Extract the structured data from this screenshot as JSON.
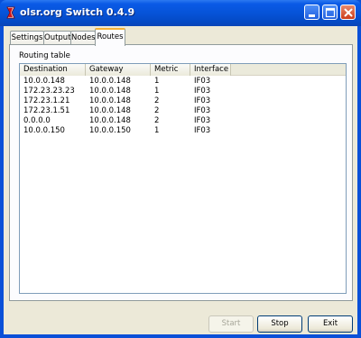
{
  "window": {
    "title": "olsr.org Switch 0.4.9",
    "colors": {
      "titlebar": "#0653d8",
      "tab_highlight": "#f4b337",
      "face": "#ece9d8"
    }
  },
  "tabs": [
    {
      "label": "Settings"
    },
    {
      "label": "Output"
    },
    {
      "label": "Nodes"
    },
    {
      "label": "Routes",
      "selected": true
    }
  ],
  "routes_panel": {
    "section_label": "Routing table",
    "columns": [
      "Destination",
      "Gateway",
      "Metric",
      "Interface"
    ],
    "rows": [
      [
        "10.0.0.148",
        "10.0.0.148",
        "1",
        "IF03"
      ],
      [
        "172.23.23.23",
        "10.0.0.148",
        "1",
        "IF03"
      ],
      [
        "172.23.1.21",
        "10.0.0.148",
        "2",
        "IF03"
      ],
      [
        "172.23.1.51",
        "10.0.0.148",
        "2",
        "IF03"
      ],
      [
        "0.0.0.0",
        "10.0.0.148",
        "2",
        "IF03"
      ],
      [
        "10.0.0.150",
        "10.0.0.150",
        "1",
        "IF03"
      ]
    ]
  },
  "buttons": {
    "start": {
      "label": "Start",
      "enabled": false
    },
    "stop": {
      "label": "Stop",
      "enabled": true
    },
    "exit": {
      "label": "Exit",
      "enabled": true
    }
  },
  "icons": {
    "app": "olsr-app-icon",
    "minimize": "minimize-icon",
    "maximize": "maximize-icon",
    "close": "close-icon"
  }
}
